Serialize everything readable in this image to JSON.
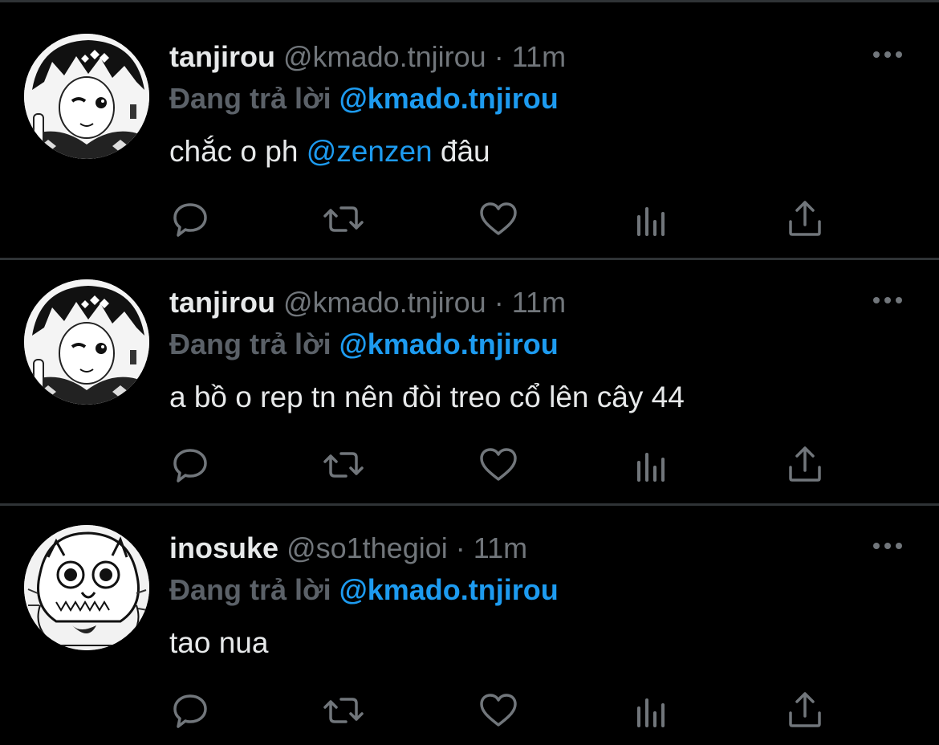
{
  "tweets": [
    {
      "name": "tanjirou",
      "handle": "@kmado.tnjirou",
      "dot": "·",
      "time": "11m",
      "reply_prefix": "Đang trả lời",
      "reply_to": "@kmado.tnjirou",
      "text_before": "chắc o ph ",
      "mention": "@zenzen",
      "text_after": " đâu",
      "avatar_icon": "tanjirou-avatar"
    },
    {
      "name": "tanjirou",
      "handle": "@kmado.tnjirou",
      "dot": "·",
      "time": "11m",
      "reply_prefix": "Đang trả lời",
      "reply_to": "@kmado.tnjirou",
      "text_before": "a bồ o rep tn nên đòi treo cổ lên cây 44",
      "mention": "",
      "text_after": "",
      "avatar_icon": "tanjirou-avatar"
    },
    {
      "name": "inosuke",
      "handle": "@so1thegioi",
      "dot": "·",
      "time": "11m",
      "reply_prefix": "Đang trả lời",
      "reply_to": "@kmado.tnjirou",
      "text_before": "tao nua",
      "mention": "",
      "text_after": "",
      "avatar_icon": "inosuke-avatar"
    }
  ],
  "actions": [
    "reply-icon",
    "retweet-icon",
    "like-icon",
    "views-icon",
    "share-icon"
  ],
  "colors": {
    "background": "#000000",
    "text": "#e7e9ea",
    "secondary": "#71767b",
    "accent": "#1d9bf0",
    "divider": "#2f3336"
  }
}
